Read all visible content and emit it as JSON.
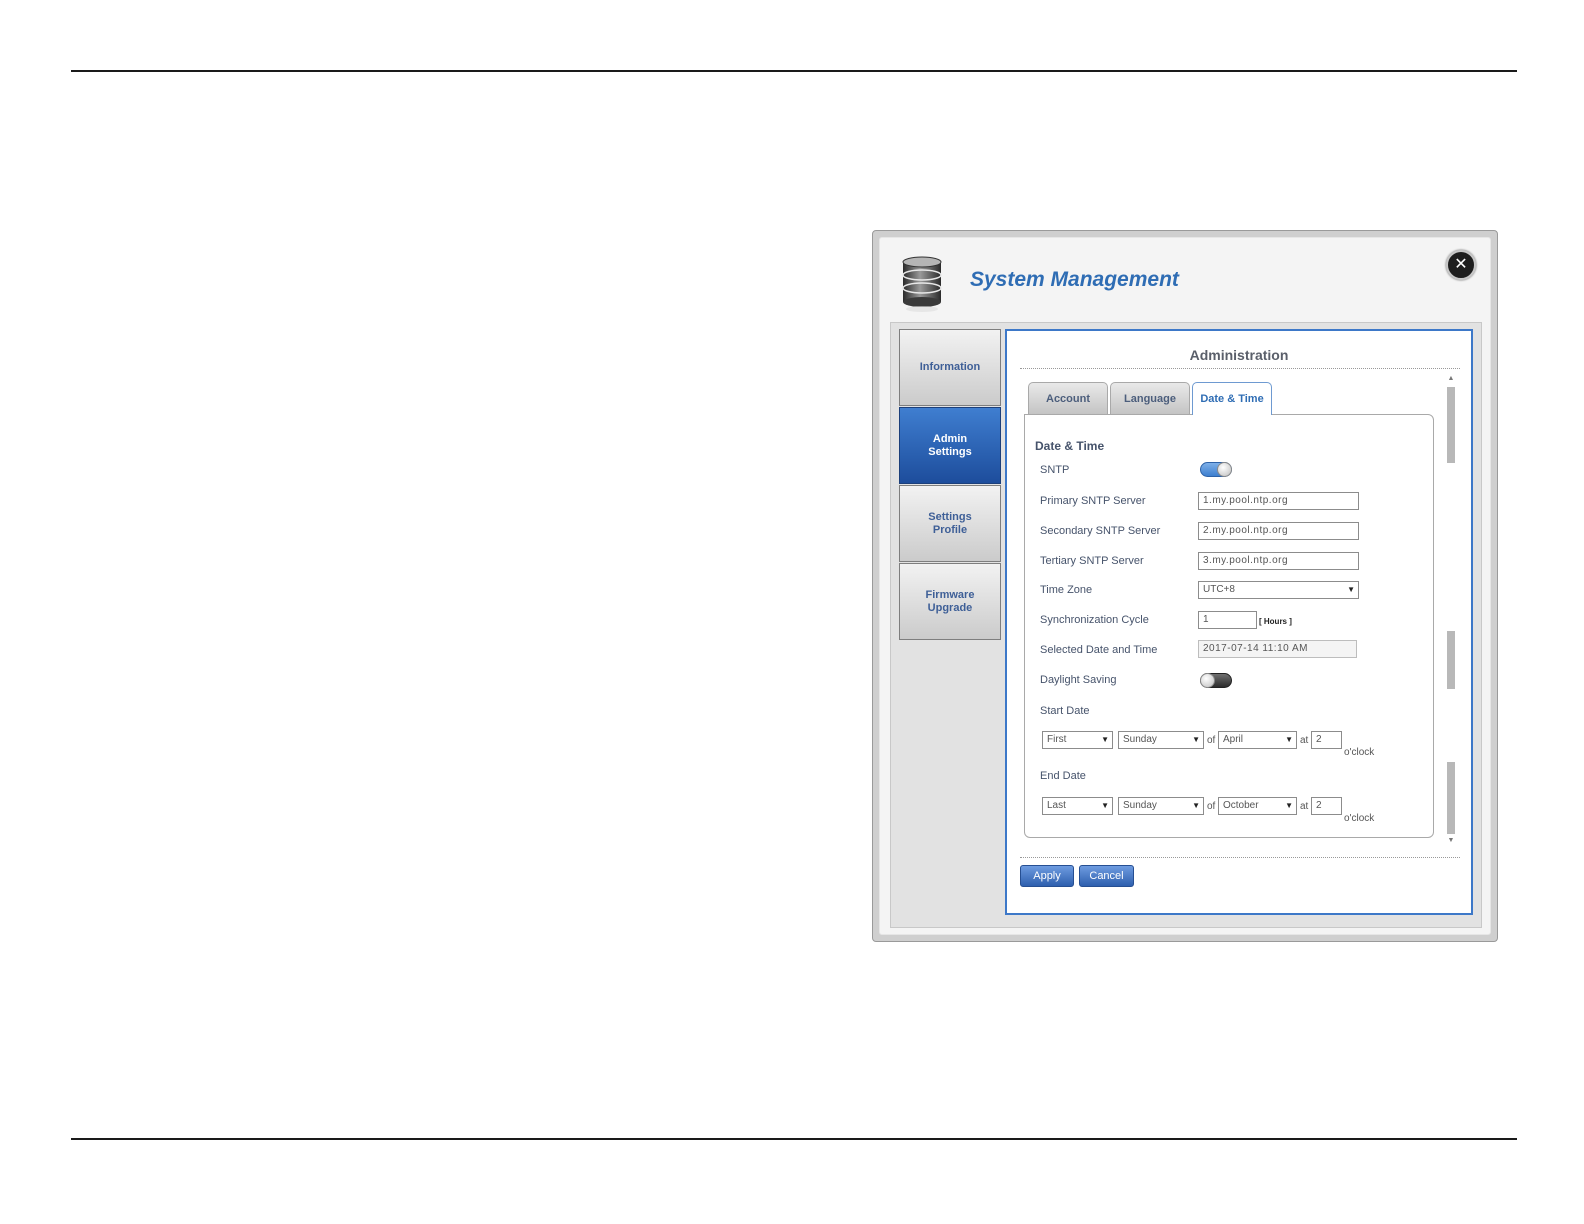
{
  "dialog": {
    "title": "System Management",
    "close_icon": "close-icon",
    "app_icon": "database-icon"
  },
  "sidebar": {
    "items": [
      {
        "label": "Information",
        "active": false
      },
      {
        "label": "Admin\nSettings",
        "active": true
      },
      {
        "label": "Settings\nProfile",
        "active": false
      },
      {
        "label": "Firmware\nUpgrade",
        "active": false
      }
    ]
  },
  "content": {
    "title": "Administration",
    "tabs": [
      {
        "label": "Account",
        "active": false
      },
      {
        "label": "Language",
        "active": false
      },
      {
        "label": "Date & Time",
        "active": true
      }
    ]
  },
  "form": {
    "heading": "Date & Time",
    "sntp_label": "SNTP",
    "sntp_enabled": true,
    "primary_label": "Primary SNTP Server",
    "primary_value": "1.my.pool.ntp.org",
    "secondary_label": "Secondary SNTP Server",
    "secondary_value": "2.my.pool.ntp.org",
    "tertiary_label": "Tertiary SNTP Server",
    "tertiary_value": "3.my.pool.ntp.org",
    "timezone_label": "Time Zone",
    "timezone_value": "UTC+8",
    "sync_label": "Synchronization Cycle",
    "sync_value": "1",
    "sync_unit": "[ Hours ]",
    "selected_label": "Selected Date and Time",
    "selected_value": "2017-07-14 11:10 AM",
    "dst_label": "Daylight Saving",
    "dst_enabled": false,
    "start_label": "Start Date",
    "start_week": "First",
    "start_day": "Sunday",
    "start_month": "April",
    "start_hour": "2",
    "end_label": "End Date",
    "end_week": "Last",
    "end_day": "Sunday",
    "end_month": "October",
    "end_hour": "2",
    "of_text": "of",
    "at_text": "at",
    "oclock_text": "o'clock"
  },
  "buttons": {
    "apply": "Apply",
    "cancel": "Cancel"
  }
}
